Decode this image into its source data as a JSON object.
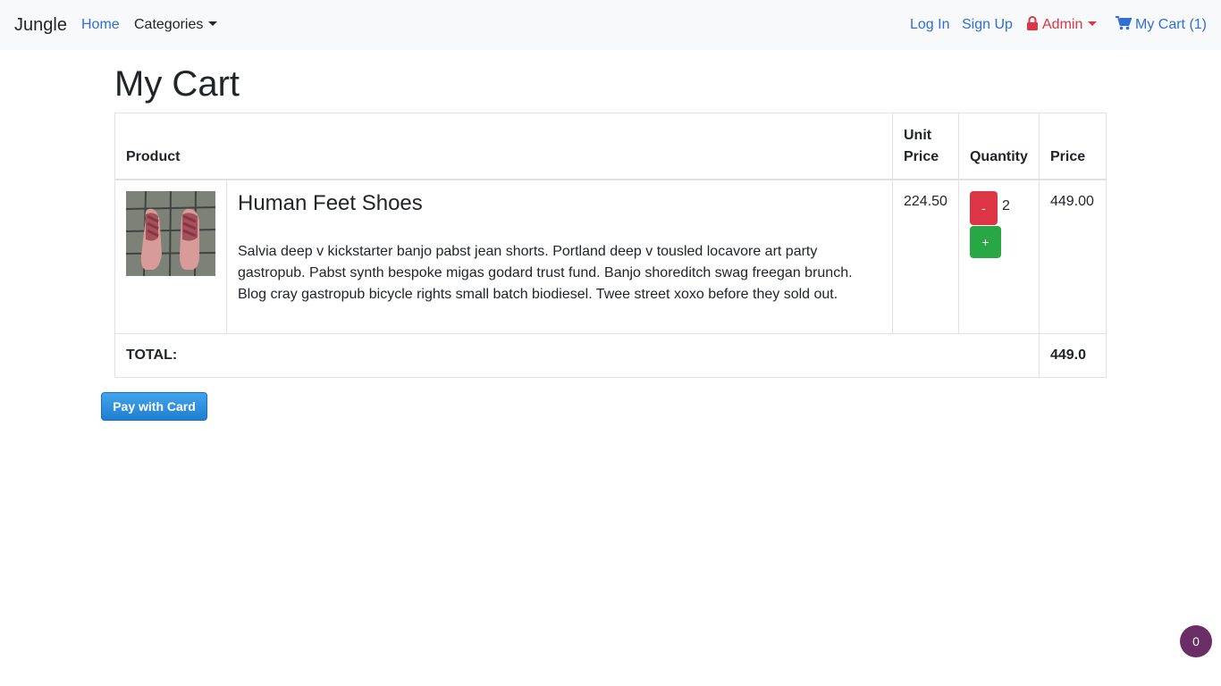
{
  "navbar": {
    "brand": "Jungle",
    "home": "Home",
    "categories": "Categories",
    "login": "Log In",
    "signup": "Sign Up",
    "admin": "Admin",
    "cart": "My Cart (1)",
    "admin_icon": "lock-icon",
    "cart_icon": "shopping-cart-icon"
  },
  "page": {
    "title": "My Cart"
  },
  "table": {
    "headers": {
      "product": "Product",
      "unit_price": "Unit Price",
      "quantity": "Quantity",
      "price": "Price"
    },
    "items": [
      {
        "name": "Human Feet Shoes",
        "description": "Salvia deep v kickstarter banjo pabst jean shorts. Portland deep v tousled locavore art party gastropub. Pabst synth bespoke migas godard trust fund. Banjo shoreditch swag freegan brunch. Blog cray gastropub bicycle rights small batch biodiesel. Twee street xoxo before they sold out.",
        "unit_price": "224.50",
        "quantity": "2",
        "price": "449.00",
        "decrement_label": "-",
        "increment_label": "+"
      }
    ],
    "total_label": "TOTAL:",
    "total_value": "449.0"
  },
  "pay_button": "Pay with Card",
  "floating_badge": "0",
  "colors": {
    "link": "#2f6fd6",
    "admin": "#dc3545",
    "minus": "#dc3545",
    "plus": "#28a745",
    "badge": "#6b2d66"
  }
}
